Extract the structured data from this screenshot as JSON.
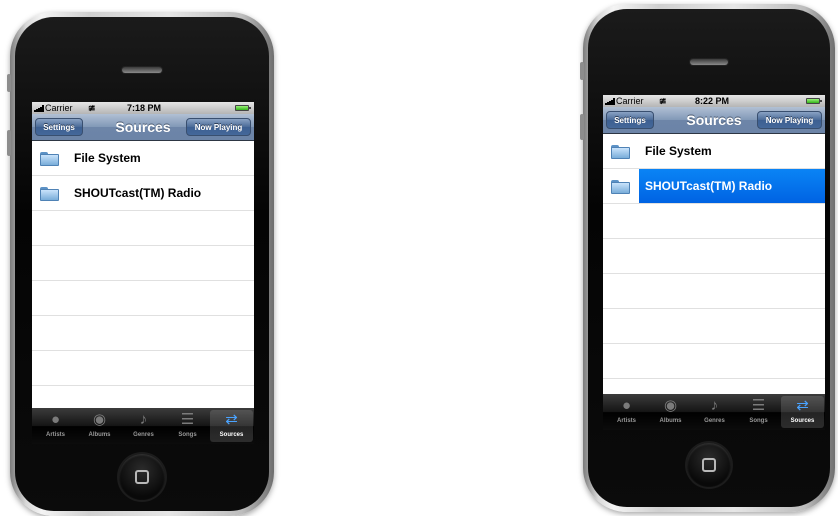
{
  "phones": [
    {
      "status": {
        "carrier": "Carrier",
        "time": "7:18 PM"
      },
      "nav": {
        "title": "Sources",
        "left_button": "Settings",
        "right_button": "Now Playing"
      },
      "rows": [
        {
          "label": "File System",
          "icon": "folder-icon",
          "selected": false
        },
        {
          "label": "SHOUTcast(TM) Radio",
          "icon": "folder-icon",
          "selected": false
        }
      ],
      "tabs": [
        {
          "label": "Artists",
          "icon": "artists-icon",
          "active": false
        },
        {
          "label": "Albums",
          "icon": "albums-icon",
          "active": false
        },
        {
          "label": "Genres",
          "icon": "genres-icon",
          "active": false
        },
        {
          "label": "Songs",
          "icon": "songs-icon",
          "active": false
        },
        {
          "label": "Sources",
          "icon": "sources-icon",
          "active": true
        }
      ]
    },
    {
      "status": {
        "carrier": "Carrier",
        "time": "8:22 PM"
      },
      "nav": {
        "title": "Sources",
        "left_button": "Settings",
        "right_button": "Now Playing"
      },
      "rows": [
        {
          "label": "File System",
          "icon": "folder-icon",
          "selected": false
        },
        {
          "label": "SHOUTcast(TM) Radio",
          "icon": "folder-icon",
          "selected": true
        }
      ],
      "tabs": [
        {
          "label": "Artists",
          "icon": "artists-icon",
          "active": false
        },
        {
          "label": "Albums",
          "icon": "albums-icon",
          "active": false
        },
        {
          "label": "Genres",
          "icon": "genres-icon",
          "active": false
        },
        {
          "label": "Songs",
          "icon": "songs-icon",
          "active": false
        },
        {
          "label": "Sources",
          "icon": "sources-icon",
          "active": true
        }
      ]
    }
  ],
  "colors": {
    "selection": "#0a6ef0",
    "navbar": "#6d85a8",
    "active_tab_icon": "#4aa3ff"
  }
}
